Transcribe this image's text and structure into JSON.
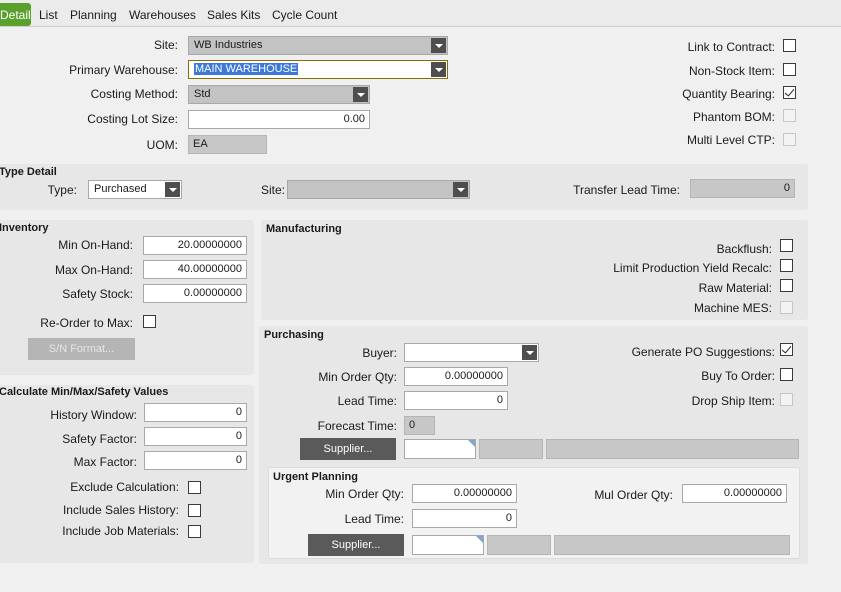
{
  "tabs": [
    "Detail",
    "List",
    "Planning",
    "Warehouses",
    "Sales Kits",
    "Cycle Count"
  ],
  "top": {
    "site_label": "Site:",
    "site_value": "WB Industries",
    "primary_wh_label": "Primary Warehouse:",
    "primary_wh_value": "MAIN WAREHOUSE",
    "costing_method_label": "Costing Method:",
    "costing_method_value": "Std",
    "costing_lot_label": "Costing Lot Size:",
    "costing_lot_value": "0.00",
    "uom_label": "UOM:",
    "uom_value": "EA",
    "link_contract_label": "Link to Contract:",
    "link_contract_checked": false,
    "non_stock_label": "Non-Stock Item:",
    "non_stock_checked": false,
    "qty_bearing_label": "Quantity Bearing:",
    "qty_bearing_checked": true,
    "phantom_bom_label": "Phantom BOM:",
    "multi_level_label": "Multi Level CTP:"
  },
  "type_detail": {
    "title": "Type Detail",
    "type_label": "Type:",
    "type_value": "Purchased",
    "site_label": "Site:",
    "site_value": "",
    "transfer_label": "Transfer Lead Time:",
    "transfer_value": "0"
  },
  "inventory": {
    "title": "Inventory",
    "min_label": "Min On-Hand:",
    "min_value": "20.00000000",
    "max_label": "Max On-Hand:",
    "max_value": "40.00000000",
    "safety_label": "Safety Stock:",
    "safety_value": "0.00000000",
    "reorder_label": "Re-Order to Max:",
    "sn_button": "S/N Format..."
  },
  "calc": {
    "title": "Calculate Min/Max/Safety Values",
    "history_label": "History Window:",
    "history_value": "0",
    "safety_factor_label": "Safety Factor:",
    "safety_factor_value": "0",
    "max_factor_label": "Max Factor:",
    "max_factor_value": "0",
    "exclude_label": "Exclude Calculation:",
    "sales_history_label": "Include Sales History:",
    "job_materials_label": "Include Job Materials:"
  },
  "manufacturing": {
    "title": "Manufacturing",
    "backflush_label": "Backflush:",
    "limit_yield_label": "Limit Production Yield Recalc:",
    "raw_material_label": "Raw Material:",
    "machine_mes_label": "Machine MES:"
  },
  "purchasing": {
    "title": "Purchasing",
    "buyer_label": "Buyer:",
    "buyer_value": "",
    "min_order_label": "Min Order Qty:",
    "min_order_value": "0.00000000",
    "lead_time_label": "Lead Time:",
    "lead_time_value": "0",
    "forecast_label": "Forecast Time:",
    "forecast_value": "0",
    "supplier_button": "Supplier...",
    "gen_po_label": "Generate PO Suggestions:",
    "gen_po_checked": true,
    "buy_to_order_label": "Buy To Order:",
    "drop_ship_label": "Drop Ship Item:"
  },
  "urgent": {
    "title": "Urgent Planning",
    "min_order_label": "Min Order Qty:",
    "min_order_value": "0.00000000",
    "lead_time_label": "Lead Time:",
    "lead_time_value": "0",
    "mul_order_label": "Mul Order Qty:",
    "mul_order_value": "0.00000000",
    "supplier_button": "Supplier..."
  }
}
